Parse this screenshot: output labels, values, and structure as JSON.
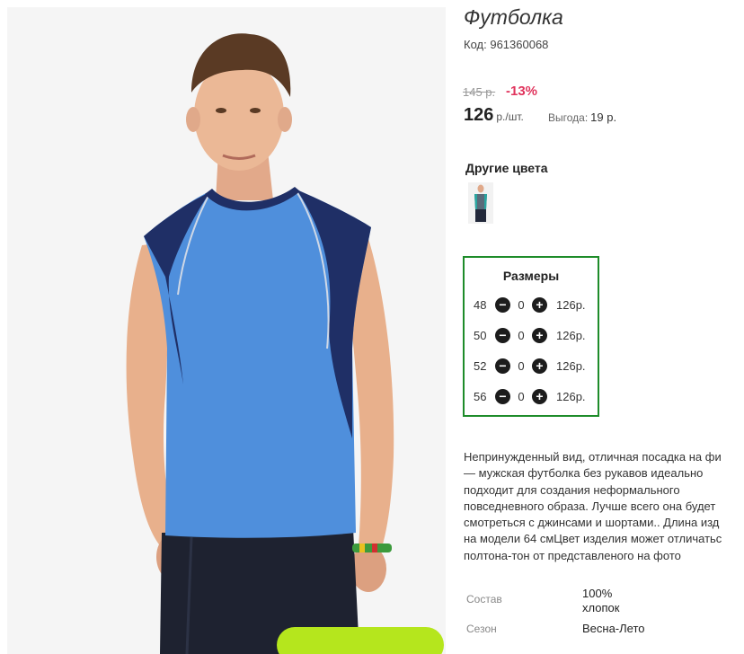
{
  "product": {
    "title": "Футболка",
    "code_label": "Код:",
    "code": "961360068",
    "old_price": "145 р.",
    "discount": "-13%",
    "price": "126",
    "price_unit": "р./шт.",
    "savings_label": "Выгода:",
    "savings_value": "19 р."
  },
  "other_colors": {
    "title": "Другие цвета"
  },
  "sizes": {
    "title": "Размеры",
    "minus_icon": "minus-icon",
    "plus_icon": "plus-icon",
    "rows": [
      {
        "size": "48",
        "qty": "0",
        "price": "126р."
      },
      {
        "size": "50",
        "qty": "0",
        "price": "126р."
      },
      {
        "size": "52",
        "qty": "0",
        "price": "126р."
      },
      {
        "size": "56",
        "qty": "0",
        "price": "126р."
      }
    ]
  },
  "description": {
    "lines": [
      "Непринужденный вид, отличная посадка на фи",
      "— мужская футболка без рукавов идеально",
      "подходит для создания неформального",
      "повседневного образа. Лучше всего она будет",
      "смотреться с джинсами и шортами.. Длина изд",
      "на модели 64 смЦвет изделия может отличатьс",
      "полтона-тон от представленого на фото"
    ]
  },
  "specs": {
    "composition_label": "Состав",
    "composition_value_1": "100%",
    "composition_value_2": "хлопок",
    "season_label": "Сезон",
    "season_value": "Весна-Лето"
  },
  "colors": {
    "accent_green": "#1e8c2a",
    "discount_red": "#e0335c",
    "cart_button": "#b5e61d",
    "shirt_blue": "#4f8fdc",
    "shirt_navy": "#1f2f66"
  }
}
